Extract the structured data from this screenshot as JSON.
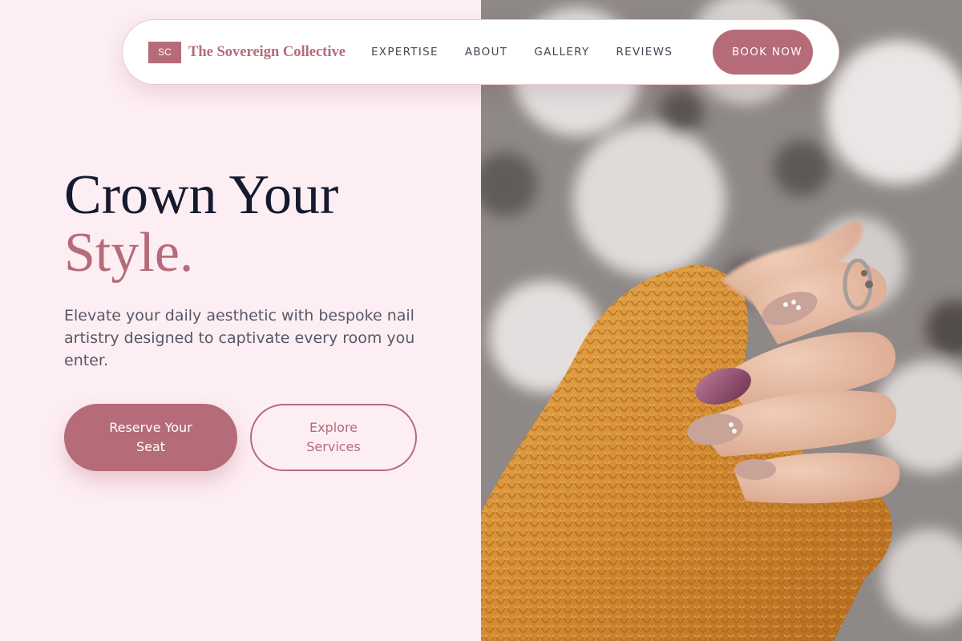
{
  "brand": {
    "mark": "SC",
    "name": "The Sovereign Collective"
  },
  "nav": {
    "links": [
      "EXPERTISE",
      "ABOUT",
      "GALLERY",
      "REVIEWS"
    ],
    "book_label": "BOOK NOW"
  },
  "hero": {
    "headline_line1": "Crown Your",
    "headline_line2": "Style.",
    "subtext": "Elevate your daily aesthetic with bespoke nail artistry designed to captivate every room you enter.",
    "cta_primary": "Reserve Your Seat",
    "cta_secondary": "Explore Services",
    "image": "manicured-hand-with-knit-sweater"
  },
  "colors": {
    "accent": "#b56b78",
    "background": "#fdeef3",
    "heading": "#161a2e",
    "body_text": "#575866",
    "nav_text": "#464654"
  },
  "icons": [
    "brand-logo-mark"
  ]
}
